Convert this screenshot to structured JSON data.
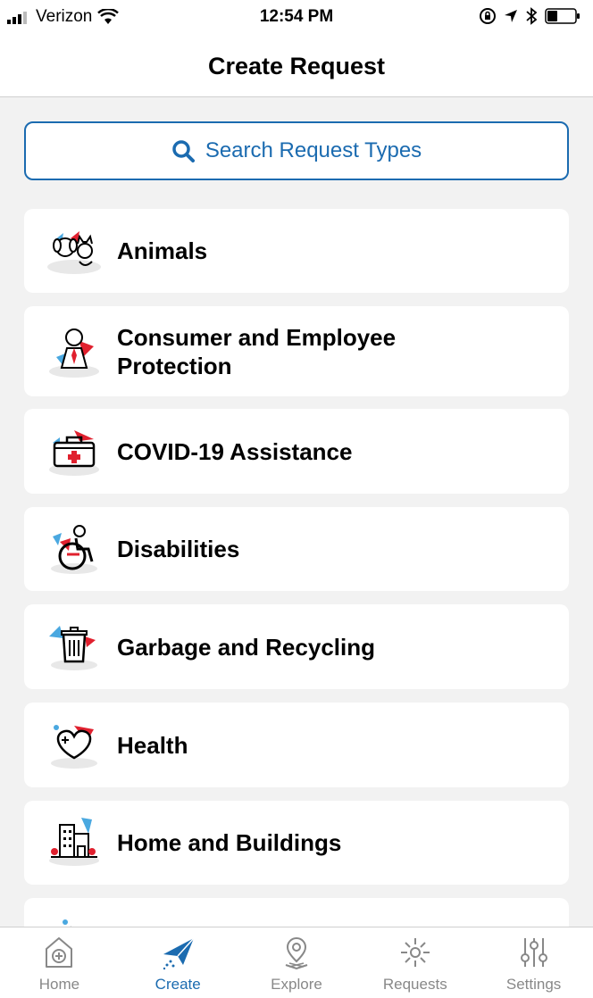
{
  "status": {
    "carrier": "Verizon",
    "time": "12:54 PM"
  },
  "header": {
    "title": "Create Request"
  },
  "search": {
    "label": "Search Request Types"
  },
  "categories": [
    {
      "label": "Animals",
      "icon": "animals-icon"
    },
    {
      "label": "Consumer and Employee\nProtection",
      "icon": "consumer-protection-icon"
    },
    {
      "label": "COVID-19 Assistance",
      "icon": "first-aid-kit-icon"
    },
    {
      "label": "Disabilities",
      "icon": "accessibility-icon"
    },
    {
      "label": "Garbage and Recycling",
      "icon": "trash-can-icon"
    },
    {
      "label": "Health",
      "icon": "heart-icon"
    },
    {
      "label": "Home and Buildings",
      "icon": "buildings-icon"
    }
  ],
  "tabs": [
    {
      "label": "Home",
      "icon": "home-icon",
      "active": false
    },
    {
      "label": "Create",
      "icon": "paper-plane-icon",
      "active": true
    },
    {
      "label": "Explore",
      "icon": "map-pin-icon",
      "active": false
    },
    {
      "label": "Requests",
      "icon": "sparkle-icon",
      "active": false
    },
    {
      "label": "Settings",
      "icon": "sliders-icon",
      "active": false
    }
  ],
  "colors": {
    "accent": "#1b6bb0",
    "red": "#e0202e",
    "lightblue": "#4aa8e0"
  }
}
